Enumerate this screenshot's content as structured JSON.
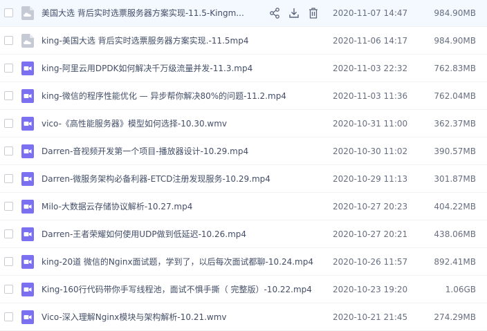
{
  "files": [
    {
      "name": "美国大选 背后实时选票服务器方案实现-11.5-Kingm...",
      "date": "2020-11-07 14:47",
      "size": "984.90MB",
      "type": "generic",
      "icon": "cloud-file-icon",
      "active": true
    },
    {
      "name": "king-美国大选 背后实时选票服务器方案实现.-11.5mp4",
      "date": "2020-11-06 14:17",
      "size": "984.90MB",
      "type": "generic",
      "icon": "cloud-file-icon"
    },
    {
      "name": "king-阿里云用DPDK如何解决千万级流量并发-11.3.mp4",
      "date": "2020-11-03 22:32",
      "size": "762.83MB",
      "type": "video",
      "icon": "video-file-icon"
    },
    {
      "name": "king-微信的程序性能优化 — 异步帮你解决80%的问题-11.2.mp4",
      "date": "2020-11-03 11:36",
      "size": "762.04MB",
      "type": "video",
      "icon": "video-file-icon"
    },
    {
      "name": "vico-《高性能服务器》模型如何选择-10.30.wmv",
      "date": "2020-10-31 11:00",
      "size": "362.37MB",
      "type": "video",
      "icon": "video-file-icon"
    },
    {
      "name": "Darren-音视频开发第一个项目-播放器设计-10.29.mp4",
      "date": "2020-10-30 11:02",
      "size": "390.57MB",
      "type": "video",
      "icon": "video-file-icon"
    },
    {
      "name": "Darren-微服务架构必备利器-ETCD注册发现服务-10.29.mp4",
      "date": "2020-10-29 11:13",
      "size": "301.87MB",
      "type": "video",
      "icon": "video-file-icon"
    },
    {
      "name": "Milo-大数据云存储协议解析-10.27.mp4",
      "date": "2020-10-27 20:23",
      "size": "404.22MB",
      "type": "video",
      "icon": "video-file-icon"
    },
    {
      "name": "Darren-王者荣耀如何使用UDP做到低延迟-10.26.mp4",
      "date": "2020-10-27 20:21",
      "size": "438.06MB",
      "type": "video",
      "icon": "video-file-icon"
    },
    {
      "name": "king-20道 微信的Nginx面试题，学到了，以后每次面试都聊-10.24.mp4",
      "date": "2020-10-26 11:57",
      "size": "892.41MB",
      "type": "video",
      "icon": "video-file-icon"
    },
    {
      "name": "King-160行代码带你手写线程池，面试不惧手撕（ 完整版）-10.22.mp4",
      "date": "2020-10-23 19:20",
      "size": "1.06GB",
      "type": "video",
      "icon": "video-file-icon"
    },
    {
      "name": "Vico-深入理解Nginx模块与架构解析-10.21.wmv",
      "date": "2020-10-21 21:45",
      "size": "274.29MB",
      "type": "video",
      "icon": "video-file-icon"
    }
  ],
  "row_actions": [
    {
      "name": "share-icon"
    },
    {
      "name": "download-icon"
    },
    {
      "name": "delete-icon"
    }
  ],
  "colors": {
    "video_icon": "#7b6ff2",
    "generic_icon": "#c5cad5",
    "action_icon": "#5b6478",
    "active_row": "#f4f8ff"
  }
}
